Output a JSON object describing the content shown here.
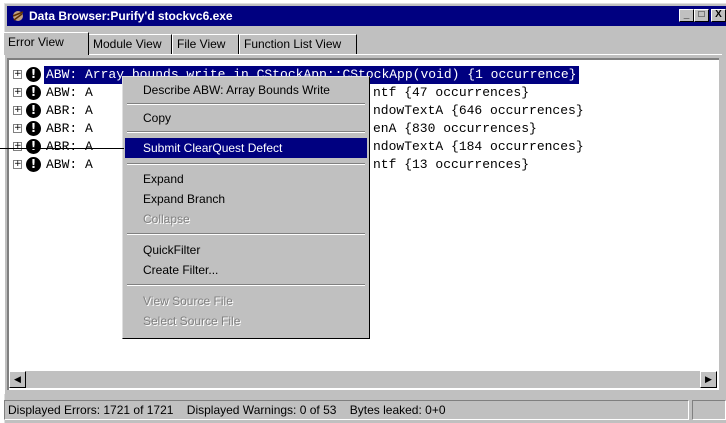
{
  "window": {
    "title": "Data Browser:Purify'd stockvc6.exe",
    "buttons": [
      "_",
      "□",
      "X"
    ]
  },
  "tabs": [
    "Error View",
    "Module View",
    "File View",
    "Function List View"
  ],
  "active_tab": "Error View",
  "rows": [
    {
      "text": "ABW: Array bounds write in CStockApp::CStockApp(void) {1 occurrence}",
      "selected": true
    },
    {
      "text": "ABW: Array bounds write in _vsprintf {47 occurrences}",
      "visible_tail": "ntf {47 occurrences}"
    },
    {
      "text": "ABR: Array bounds read in GetWindowTextA {646 occurrences}",
      "visible_tail": "ndowTextA {646 occurrences}"
    },
    {
      "text": "ABR: Array bounds read in lstrlenA {830 occurrences}",
      "visible_tail": "enA {830 occurrences}"
    },
    {
      "text": "ABR: Array bounds read in SetWindowTextA {184 occurrences}",
      "visible_tail": "ndowTextA {184 occurrences}"
    },
    {
      "text": "ABW: Array bounds write in _vsprintf {13 occurrences}",
      "visible_tail": "ntf {13 occurrences}"
    }
  ],
  "rows_visible_prefix": [
    "ABW: ",
    "ABW: A",
    "ABR: A",
    "ABR: A",
    "ABR: A",
    "ABW: A"
  ],
  "context_menu": {
    "items": [
      {
        "label": "Describe ABW: Array Bounds Write",
        "enabled": true
      },
      {
        "separator": true
      },
      {
        "label": "Copy",
        "enabled": true
      },
      {
        "separator": true
      },
      {
        "label": "Submit ClearQuest Defect",
        "enabled": true,
        "highlighted": true
      },
      {
        "separator": true
      },
      {
        "label": "Expand",
        "enabled": true
      },
      {
        "label": "Expand Branch",
        "enabled": true
      },
      {
        "label": "Collapse",
        "enabled": false
      },
      {
        "separator": true
      },
      {
        "label": "QuickFilter",
        "enabled": true
      },
      {
        "label": "Create Filter...",
        "enabled": true
      },
      {
        "separator": true
      },
      {
        "label": "View Source File",
        "enabled": false
      },
      {
        "label": "Select Source File",
        "enabled": false
      }
    ]
  },
  "status": {
    "errors": "Displayed Errors: 1721 of 1721",
    "warnings": "Displayed Warnings: 0 of 53",
    "leaked": "Bytes leaked: 0+0"
  },
  "colors": {
    "selection": "#000080",
    "face": "#c0c0c0",
    "titlebar": "#000080"
  },
  "icons": {
    "app": "purify-app-icon",
    "error": "error-exclamation-icon",
    "expander": "plus-expander-icon"
  }
}
